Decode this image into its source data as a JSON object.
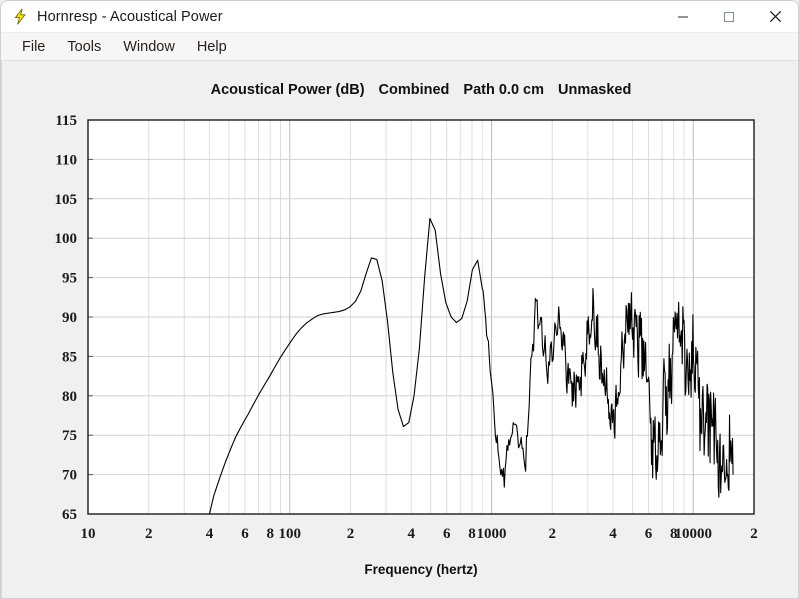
{
  "window": {
    "title": "Hornresp - Acoustical Power",
    "icon": "lightning-bolt-icon",
    "controls": {
      "minimize": "–",
      "maximize": "□",
      "close": "✕"
    }
  },
  "menu": {
    "items": [
      {
        "label": "File"
      },
      {
        "label": "Tools"
      },
      {
        "label": "Window"
      },
      {
        "label": "Help"
      }
    ]
  },
  "chart_data": {
    "type": "line",
    "title": "Acoustical Power (dB)   Combined   Path 0.0 cm   Unmasked",
    "title_parts": [
      "Acoustical Power (dB)",
      "Combined",
      "Path 0.0 cm",
      "Unmasked"
    ],
    "xlabel": "Frequency (hertz)",
    "ylabel": "",
    "xscale": "log",
    "xlim": [
      10,
      20000
    ],
    "ylim": [
      65,
      115
    ],
    "yticks": [
      65,
      70,
      75,
      80,
      85,
      90,
      95,
      100,
      105,
      110,
      115
    ],
    "xticks": [
      10,
      20,
      40,
      60,
      80,
      100,
      200,
      400,
      600,
      800,
      1000,
      2000,
      4000,
      6000,
      8000,
      10000,
      20000
    ],
    "xticklabels": [
      "10",
      "2",
      "4",
      "6",
      "8",
      "100",
      "2",
      "4",
      "6",
      "8",
      "1000",
      "2",
      "4",
      "6",
      "8",
      "10000",
      "2"
    ],
    "grid": true,
    "legend": null,
    "line_color": "#000000",
    "background": "#ffffff",
    "grid_color": "#d4d4d4",
    "series": [
      {
        "name": "Acoustical Power",
        "x": [
          40,
          42,
          45,
          48,
          51,
          54,
          58,
          62,
          66,
          70,
          75,
          80,
          85,
          90,
          96,
          102,
          108,
          115,
          122,
          130,
          138,
          147,
          156,
          166,
          176,
          187,
          199,
          212,
          225,
          239,
          254,
          270,
          287,
          305,
          324,
          344,
          366,
          389,
          413,
          439,
          466,
          495,
          526,
          559,
          594,
          631,
          670,
          712,
          757,
          804,
          854,
          908,
          965,
          1025,
          1089,
          1157,
          1230,
          1307,
          1389,
          1476,
          1568,
          1666,
          1771,
          1881,
          1999,
          2124,
          2257,
          2398,
          2548,
          2708,
          2877,
          3057,
          3248,
          3452,
          3668,
          3898,
          4142,
          4401,
          4677,
          4970,
          5281,
          5612,
          5963,
          6336,
          6733,
          7154,
          7602,
          8078,
          8583,
          9121,
          9692,
          10299,
          10944,
          11629,
          12357,
          13130,
          13952,
          14824,
          15752
        ],
        "y": [
          65.0,
          67.3,
          69.6,
          71.6,
          73.3,
          74.8,
          76.3,
          77.6,
          78.9,
          80.1,
          81.4,
          82.6,
          83.8,
          84.9,
          86.0,
          87.0,
          87.9,
          88.7,
          89.3,
          89.8,
          90.2,
          90.4,
          90.5,
          90.6,
          90.7,
          90.9,
          91.3,
          92.0,
          93.3,
          95.5,
          97.5,
          97.3,
          94.6,
          89.5,
          83.0,
          78.3,
          76.1,
          76.6,
          80.0,
          86.0,
          95.0,
          102.5,
          101.0,
          95.5,
          91.8,
          90.0,
          89.3,
          89.8,
          92.0,
          96.0,
          97.2,
          93.0,
          86.0,
          78.0,
          72.5,
          69.2,
          75.0,
          76.5,
          74.0,
          70.0,
          84.5,
          91.8,
          88.0,
          84.0,
          86.5,
          89.0,
          87.5,
          83.5,
          79.5,
          82.0,
          86.0,
          88.5,
          89.0,
          86.0,
          82.0,
          77.0,
          79.5,
          84.5,
          88.5,
          90.5,
          89.0,
          85.0,
          80.0,
          76.0,
          72.0,
          78.0,
          83.5,
          86.5,
          87.5,
          86.0,
          83.5,
          81.0,
          79.0,
          77.5,
          76.0,
          74.5,
          73.0,
          71.5,
          70.0
        ]
      }
    ],
    "description": "Acoustical power response showing low-frequency rolloff below 40 Hz, a broad passband near 90 dB from 100-200 Hz, a primary peak of 97.5 dB at 200 Hz, strong resonance peaks reaching 102.5 dB near 400 Hz, and a ragged decaying high-frequency region from 1 kHz to 16 kHz falling from roughly 90 dB to 66 dB."
  }
}
